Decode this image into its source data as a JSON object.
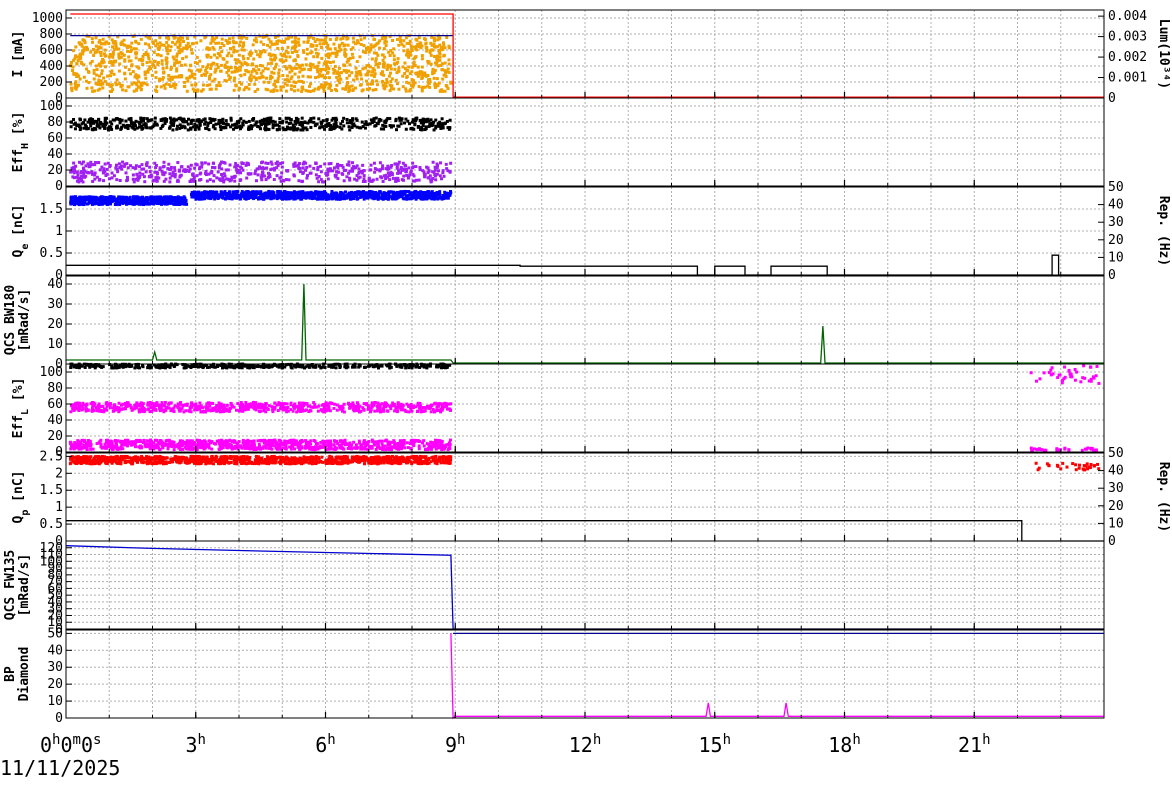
{
  "date_label": "11/11/2025",
  "colors": {
    "orange": "#f0a000",
    "red": "#ff0000",
    "navy": "#00008b",
    "black": "#000000",
    "purple": "#a020f0",
    "blue": "#0000ff",
    "green": "#006400",
    "magenta": "#ff00ff",
    "darkblue": "#0000cd",
    "grid": "#b0b0b0"
  },
  "chart_data": [
    {
      "id": "current",
      "type": "scatter",
      "ylabel": "I [mA]",
      "ylabel_sub": "",
      "ylim": [
        0,
        1100
      ],
      "yticks": [
        0,
        200,
        400,
        600,
        800,
        1000
      ],
      "ylabel2": "Lum(10³⁴)",
      "y2lim": [
        0,
        0.0043
      ],
      "y2ticks": [
        0,
        0.001,
        0.002,
        0.003,
        0.004
      ],
      "series": [
        {
          "kind": "scatter_band",
          "color": "orange",
          "x_range": [
            0.1,
            8.9
          ],
          "y_range": [
            80,
            780
          ],
          "density": 1400
        },
        {
          "kind": "step",
          "color": "navy",
          "points": [
            [
              0.1,
              780
            ],
            [
              8.95,
              780
            ]
          ]
        },
        {
          "kind": "step",
          "color": "red",
          "points": [
            [
              0.1,
              1050
            ],
            [
              8.95,
              1050
            ],
            [
              8.95,
              10
            ],
            [
              24,
              10
            ]
          ]
        }
      ]
    },
    {
      "id": "effh",
      "type": "scatter",
      "ylabel": "Eff",
      "ylabel_sub": "H",
      "ylabel_suffix": " [%]",
      "ylim": [
        0,
        110
      ],
      "yticks": [
        0,
        20,
        40,
        60,
        80,
        100
      ],
      "series": [
        {
          "kind": "scatter_band",
          "color": "black",
          "x_range": [
            0.1,
            8.9
          ],
          "y_range": [
            70,
            85
          ],
          "density": 600
        },
        {
          "kind": "scatter_band",
          "color": "purple",
          "x_range": [
            0.1,
            8.9
          ],
          "y_range": [
            5,
            30
          ],
          "density": 600
        }
      ]
    },
    {
      "id": "qe",
      "type": "scatter",
      "ylabel": "Q",
      "ylabel_sub": "e",
      "ylabel_suffix": " [nC]",
      "ylim": [
        0,
        2.0
      ],
      "yticks": [
        0,
        0.5,
        1,
        1.5
      ],
      "ylabel2": "Rep. (Hz)",
      "y2lim": [
        0,
        50
      ],
      "y2ticks": [
        0,
        10,
        20,
        30,
        40,
        50
      ],
      "series": [
        {
          "kind": "scatter_band",
          "color": "blue",
          "x_range": [
            0.1,
            2.8
          ],
          "y_range": [
            1.6,
            1.78
          ],
          "density": 500
        },
        {
          "kind": "scatter_band",
          "color": "blue",
          "x_range": [
            2.9,
            8.9
          ],
          "y_range": [
            1.72,
            1.9
          ],
          "density": 900
        },
        {
          "kind": "step",
          "color": "black",
          "points": [
            [
              0,
              0.22
            ],
            [
              10.5,
              0.22
            ],
            [
              10.5,
              0.2
            ],
            [
              14.6,
              0.2
            ],
            [
              14.6,
              0.0
            ],
            [
              15.0,
              0.0
            ],
            [
              15.0,
              0.2
            ],
            [
              15.7,
              0.2
            ],
            [
              15.7,
              0.0
            ],
            [
              16.3,
              0.0
            ],
            [
              16.3,
              0.2
            ],
            [
              17.6,
              0.2
            ],
            [
              17.6,
              0.0
            ],
            [
              22.8,
              0.0
            ],
            [
              22.8,
              0.45
            ],
            [
              22.95,
              0.45
            ],
            [
              22.95,
              0.0
            ],
            [
              24,
              0.0
            ]
          ]
        }
      ]
    },
    {
      "id": "qcs_bw",
      "type": "line",
      "ylabel": "QCS BW180",
      "ylabel_line2": "[mRad/s]",
      "ylim": [
        0,
        44
      ],
      "yticks": [
        0,
        10,
        20,
        30,
        40
      ],
      "series": [
        {
          "kind": "line",
          "color": "green",
          "points": [
            [
              0,
              2
            ],
            [
              2.0,
              2
            ],
            [
              2.05,
              6
            ],
            [
              2.1,
              2
            ],
            [
              5.45,
              2
            ],
            [
              5.5,
              40
            ],
            [
              5.55,
              2
            ],
            [
              8.9,
              2
            ],
            [
              8.95,
              0.5
            ],
            [
              17.45,
              0.5
            ],
            [
              17.5,
              19
            ],
            [
              17.55,
              0.5
            ],
            [
              24,
              0.5
            ]
          ]
        }
      ]
    },
    {
      "id": "effl",
      "type": "scatter",
      "ylabel": "Eff",
      "ylabel_sub": "L",
      "ylabel_suffix": " [%]",
      "ylim": [
        0,
        110
      ],
      "yticks": [
        0,
        20,
        40,
        60,
        80,
        100
      ],
      "series": [
        {
          "kind": "scatter_band",
          "color": "black",
          "x_range": [
            0.1,
            8.9
          ],
          "y_range": [
            105,
            110
          ],
          "density": 400
        },
        {
          "kind": "scatter_band",
          "color": "magenta",
          "x_range": [
            0.1,
            8.9
          ],
          "y_range": [
            50,
            62
          ],
          "density": 700
        },
        {
          "kind": "scatter_band",
          "color": "magenta",
          "x_range": [
            0.1,
            8.9
          ],
          "y_range": [
            3,
            15
          ],
          "density": 900
        },
        {
          "kind": "scatter_band",
          "color": "magenta",
          "x_range": [
            22.3,
            23.9
          ],
          "y_range": [
            85,
            108
          ],
          "density": 40
        },
        {
          "kind": "scatter_band",
          "color": "magenta",
          "x_range": [
            22.3,
            23.9
          ],
          "y_range": [
            2,
            5
          ],
          "density": 30
        }
      ]
    },
    {
      "id": "qp",
      "type": "scatter",
      "ylabel": "Q",
      "ylabel_sub": "p",
      "ylabel_suffix": " [nC]",
      "ylim": [
        0,
        2.6
      ],
      "yticks": [
        0,
        0.5,
        1,
        1.5,
        2,
        2.5
      ],
      "ylabel2": "Rep. (Hz)",
      "y2lim": [
        0,
        50
      ],
      "y2ticks": [
        0,
        10,
        20,
        30,
        40,
        50
      ],
      "series": [
        {
          "kind": "scatter_band",
          "color": "red",
          "x_range": [
            0.1,
            8.9
          ],
          "y_range": [
            2.28,
            2.5
          ],
          "density": 1100
        },
        {
          "kind": "scatter_band",
          "color": "red",
          "x_range": [
            22.3,
            23.9
          ],
          "y_range": [
            2.1,
            2.3
          ],
          "density": 30
        },
        {
          "kind": "step",
          "color": "black",
          "points": [
            [
              0,
              0.6
            ],
            [
              22.1,
              0.6
            ],
            [
              22.1,
              0.0
            ],
            [
              24,
              0.0
            ]
          ]
        }
      ]
    },
    {
      "id": "qcs_fw",
      "type": "line",
      "ylabel": "QCS FW135",
      "ylabel_line2": "[mRad/s]",
      "ylim": [
        0,
        130
      ],
      "yticks": [
        0,
        10,
        20,
        30,
        40,
        50,
        60,
        70,
        80,
        90,
        100,
        110,
        120
      ],
      "series": [
        {
          "kind": "line",
          "color": "darkblue",
          "points": [
            [
              0,
              123
            ],
            [
              2,
              119
            ],
            [
              4,
              116
            ],
            [
              6,
              113
            ],
            [
              8.9,
              109
            ],
            [
              8.95,
              0
            ],
            [
              24,
              0
            ]
          ]
        }
      ]
    },
    {
      "id": "bp_diamond",
      "type": "line",
      "ylabel": "BP",
      "ylabel_line2": "Diamond",
      "ylim": [
        0,
        52
      ],
      "yticks": [
        0,
        10,
        20,
        30,
        40,
        50
      ],
      "series": [
        {
          "kind": "line",
          "color": "navy",
          "points": [
            [
              8.95,
              50
            ],
            [
              24,
              50
            ]
          ]
        },
        {
          "kind": "line",
          "color": "magenta",
          "points": [
            [
              8.9,
              50
            ],
            [
              8.95,
              0
            ],
            [
              9.0,
              1
            ],
            [
              14.8,
              1
            ],
            [
              14.85,
              9
            ],
            [
              14.9,
              1
            ],
            [
              16.6,
              1
            ],
            [
              16.65,
              9
            ],
            [
              16.7,
              1
            ],
            [
              24,
              1
            ]
          ]
        }
      ]
    }
  ],
  "x_axis": {
    "range": [
      0,
      24
    ],
    "major": [
      0,
      3,
      6,
      9,
      12,
      15,
      18,
      21
    ],
    "labels": [
      {
        "x": 0,
        "parts": [
          [
            "0",
            "h"
          ],
          [
            "0",
            "m"
          ],
          [
            "0",
            "s"
          ]
        ]
      },
      {
        "x": 3,
        "parts": [
          [
            "3",
            "h"
          ]
        ]
      },
      {
        "x": 6,
        "parts": [
          [
            "6",
            "h"
          ]
        ]
      },
      {
        "x": 9,
        "parts": [
          [
            "9",
            "h"
          ]
        ]
      },
      {
        "x": 12,
        "parts": [
          [
            "12",
            "h"
          ]
        ]
      },
      {
        "x": 15,
        "parts": [
          [
            "15",
            "h"
          ]
        ]
      },
      {
        "x": 18,
        "parts": [
          [
            "18",
            "h"
          ]
        ]
      },
      {
        "x": 21,
        "parts": [
          [
            "21",
            "h"
          ]
        ]
      }
    ]
  }
}
